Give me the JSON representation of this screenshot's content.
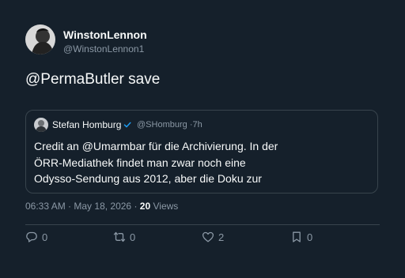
{
  "author": {
    "name": "WinstonLennon",
    "handle": "@WinstonLennon1"
  },
  "tweet": {
    "text": "@PermaButler save"
  },
  "quoted": {
    "name": "Stefan Homburg",
    "handle": "@SHomburg",
    "separator": "·",
    "time": "7h",
    "lines": [
      "Credit an @Umarmbar für die Archivierung. In der",
      "ÖRR-Mediathek findet man zwar noch eine",
      "Odysso-Sendung aus 2012, aber die Doku zur"
    ]
  },
  "meta": {
    "time": "06:33 AM",
    "separator": "·",
    "date": "May 18, 2026",
    "views_count": "20",
    "views_label": "Views"
  },
  "actions": {
    "reply_count": "0",
    "retweet_count": "0",
    "like_count": "2",
    "bookmark_count": "0"
  },
  "colors": {
    "background": "#15202b",
    "text": "#f7f9f9",
    "muted": "#8b98a5",
    "border": "#38444d",
    "verified": "#1d9bf0"
  }
}
